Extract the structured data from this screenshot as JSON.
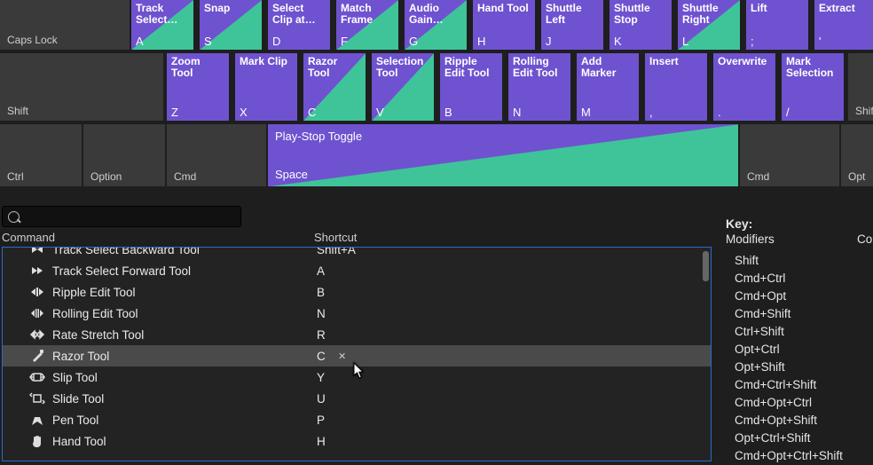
{
  "caps_row": {
    "label": "Caps Lock",
    "keys": [
      {
        "title": "Track Select…",
        "char": "A",
        "tri": true
      },
      {
        "title": "Snap",
        "char": "S",
        "tri": true
      },
      {
        "title": "Select Clip at…",
        "char": "D",
        "tri": false
      },
      {
        "title": "Match Frame",
        "char": "F",
        "tri": true
      },
      {
        "title": "Audio Gain…",
        "char": "G",
        "tri": true
      },
      {
        "title": "Hand Tool",
        "char": "H",
        "tri": false
      },
      {
        "title": "Shuttle Left",
        "char": "J",
        "tri": false
      },
      {
        "title": "Shuttle Stop",
        "char": "K",
        "tri": false
      },
      {
        "title": "Shuttle Right",
        "char": "L",
        "tri": true
      },
      {
        "title": "Lift",
        "char": ";",
        "tri": false
      },
      {
        "title": "Extract",
        "char": "'",
        "tri": false
      }
    ]
  },
  "shift_row": {
    "label": "Shift",
    "keys": [
      {
        "title": "Zoom Tool",
        "char": "Z",
        "tri": false
      },
      {
        "title": "Mark Clip",
        "char": "X",
        "tri": false
      },
      {
        "title": "Razor Tool",
        "char": "C",
        "tri": true
      },
      {
        "title": "Selection Tool",
        "char": "V",
        "tri": true
      },
      {
        "title": "Ripple Edit Tool",
        "char": "B",
        "tri": false
      },
      {
        "title": "Rolling Edit Tool",
        "char": "N",
        "tri": false
      },
      {
        "title": "Add Marker",
        "char": "M",
        "tri": false
      },
      {
        "title": "Insert",
        "char": ",",
        "tri": false
      },
      {
        "title": "Overwrite",
        "char": ".",
        "tri": false
      },
      {
        "title": "Mark Selection",
        "char": "/",
        "tri": false
      }
    ],
    "tail_label": "Shift"
  },
  "ctrl_row": {
    "left_mods": [
      "Ctrl",
      "Option",
      "Cmd"
    ],
    "space": {
      "title": "Play-Stop Toggle",
      "char": "Space"
    },
    "right_mods": [
      "Cmd",
      "Opt"
    ]
  },
  "columns": {
    "command": "Command",
    "shortcut": "Shortcut"
  },
  "commands": [
    {
      "icon": "track-back",
      "name": "Track Select Backward Tool",
      "short": "Shift+A",
      "cutoff": true
    },
    {
      "icon": "track-fwd",
      "name": "Track Select Forward Tool",
      "short": "A"
    },
    {
      "icon": "ripple",
      "name": "Ripple Edit Tool",
      "short": "B"
    },
    {
      "icon": "rolling",
      "name": "Rolling Edit Tool",
      "short": "N"
    },
    {
      "icon": "rate",
      "name": "Rate Stretch Tool",
      "short": "R"
    },
    {
      "icon": "razor",
      "name": "Razor Tool",
      "short": "C",
      "selected": true,
      "clearable": true
    },
    {
      "icon": "slip",
      "name": "Slip Tool",
      "short": "Y"
    },
    {
      "icon": "slide",
      "name": "Slide Tool",
      "short": "U"
    },
    {
      "icon": "pen",
      "name": "Pen Tool",
      "short": "P"
    },
    {
      "icon": "hand",
      "name": "Hand Tool",
      "short": "H"
    }
  ],
  "side": {
    "key_label": "Key:",
    "modifiers_label": "Modifiers",
    "col2_label": "Co",
    "list": [
      "Shift",
      "Cmd+Ctrl",
      "Cmd+Opt",
      "Cmd+Shift",
      "Ctrl+Shift",
      "Opt+Ctrl",
      "Opt+Shift",
      "Cmd+Ctrl+Shift",
      "Cmd+Opt+Ctrl",
      "Cmd+Opt+Shift",
      "Opt+Ctrl+Shift",
      "Cmd+Opt+Ctrl+Shift"
    ]
  },
  "clear_glyph": "✕"
}
